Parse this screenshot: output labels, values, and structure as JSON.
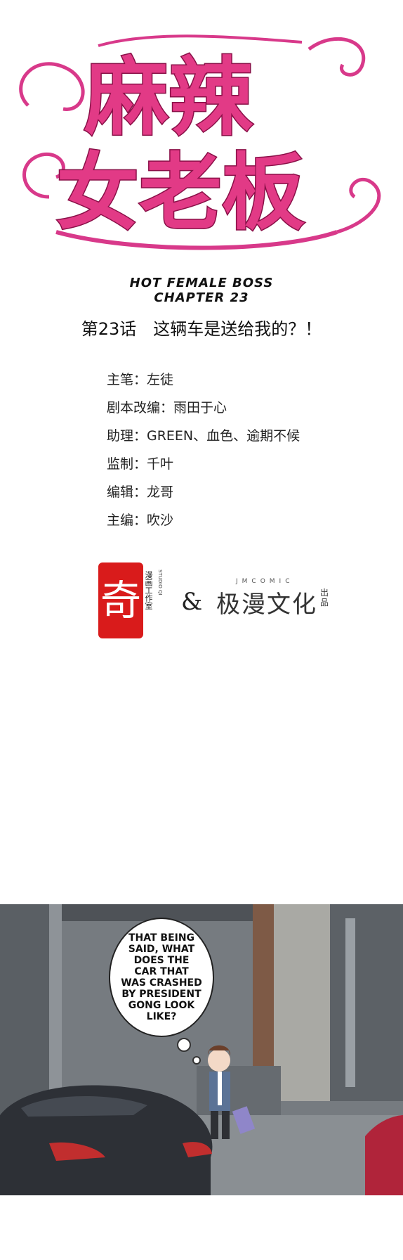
{
  "logo": {
    "title_line1": "麻辣",
    "title_line2": "女老板",
    "color": "#e23a86"
  },
  "header": {
    "title_en": "HOT FEMALE BOSS",
    "chapter_en": "CHAPTER 23",
    "chapter_cn": "第23话　这辆车是送给我的？！"
  },
  "credits": [
    "主笔：左徒",
    "剧本改编：雨田于心",
    "助理：GREEN、血色、逾期不候",
    "监制：千叶",
    "编辑：龙哥",
    "主编：吹沙"
  ],
  "studios": {
    "seal_char": "奇",
    "seal_side": "漫画工作室",
    "seal_side_small": "STUDIO QI",
    "ampersand": "&",
    "jm_small": "JMCOMIC",
    "jm_name": "极漫文化",
    "jm_out": "出品",
    "seal_color": "#d91b1b"
  },
  "panel": {
    "bubble_lines": [
      "THAT BEING",
      "SAID, WHAT",
      "DOES THE",
      "CAR THAT",
      "WAS CRASHED",
      "BY PRESIDENT",
      "GONG LOOK",
      "LIKE?"
    ]
  }
}
